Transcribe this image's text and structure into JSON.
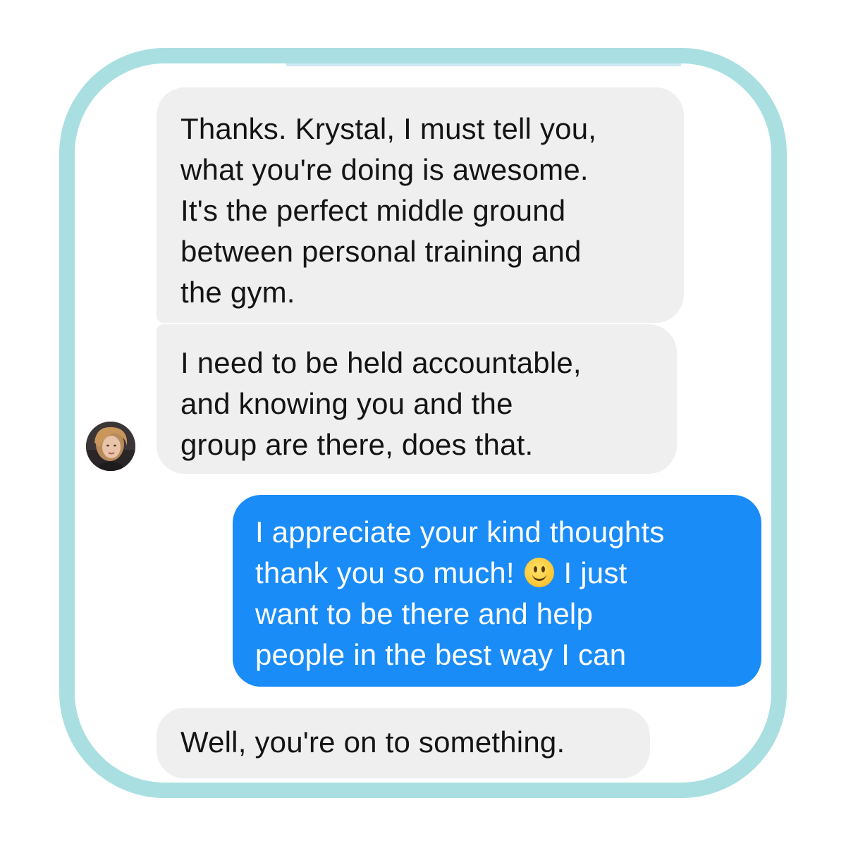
{
  "conversation": {
    "messages": [
      {
        "sender": "contact",
        "text": "Thanks. Krystal, I must tell you,\nwhat you're doing is awesome.\nIt's the perfect middle ground\nbetween personal training and\nthe gym."
      },
      {
        "sender": "contact",
        "text": "I need to be held accountable,\nand knowing you and the\ngroup are there, does that."
      },
      {
        "sender": "me",
        "text_before_emoji": "I appreciate your kind thoughts\nthank you so much! ",
        "emoji": "slightly-smiling-face",
        "text_after_emoji": " I just\nwant to be there and help\npeople in the best way I can"
      },
      {
        "sender": "contact",
        "text": "Well, you're on to something."
      }
    ]
  },
  "colors": {
    "frame_border": "#a9dfe1",
    "incoming_bubble": "#efeff0",
    "outgoing_bubble": "#1a8cf8",
    "incoming_text": "#141414",
    "outgoing_text": "#ffffff"
  },
  "icons": {
    "contact_avatar": "avatar",
    "emoji": "smiley-emoji-icon"
  }
}
